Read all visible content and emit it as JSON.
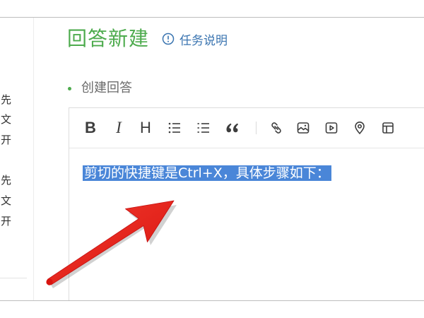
{
  "page": {
    "title": "回答新建",
    "task_link": "任务说明",
    "task_link_icon": "info-circle-icon"
  },
  "left_panel": {
    "groups": [
      [
        "先",
        "文",
        "开"
      ],
      [
        "先",
        "文",
        "开"
      ]
    ]
  },
  "section": {
    "label": "创建回答"
  },
  "toolbar": {
    "items": [
      {
        "name": "bold",
        "glyph": "B",
        "icon": "bold-icon"
      },
      {
        "name": "italic",
        "glyph": "I",
        "icon": "italic-icon"
      },
      {
        "name": "heading",
        "glyph": "H",
        "icon": "heading-icon"
      },
      {
        "name": "unordered-list",
        "icon": "unordered-list-icon"
      },
      {
        "name": "ordered-list",
        "icon": "ordered-list-icon"
      },
      {
        "name": "quote",
        "icon": "quote-icon"
      },
      {
        "name": "link",
        "icon": "link-icon"
      },
      {
        "name": "image",
        "icon": "image-icon"
      },
      {
        "name": "video",
        "icon": "video-icon"
      },
      {
        "name": "location",
        "icon": "location-pin-icon"
      },
      {
        "name": "template",
        "icon": "layout-icon"
      }
    ]
  },
  "editor": {
    "content": "剪切的快捷键是Ctrl+X，具体步骤如下：",
    "content_selected": true
  },
  "annotation": {
    "icon": "red-arrow",
    "color": "#e51c1c"
  },
  "colors": {
    "accent_green": "#4dab4d",
    "link_blue": "#3a74b0",
    "selection_blue": "#4a86d8"
  }
}
